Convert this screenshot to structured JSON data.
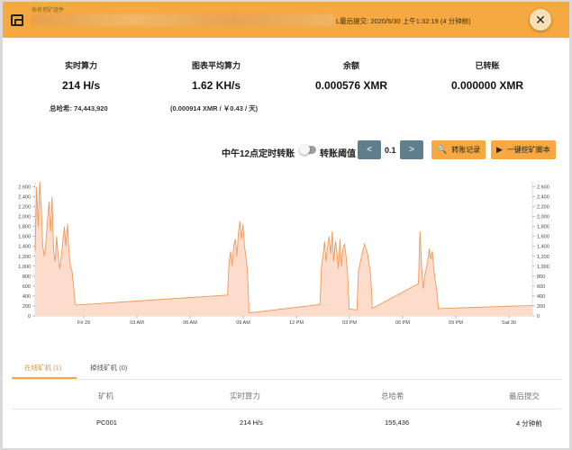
{
  "header": {
    "small_label": "命名挖矿组件",
    "last_submit": "L最后提交: 2020/5/30 上午1:32:19 (4 分钟前)",
    "close_icon": "close-icon"
  },
  "stats": {
    "realtime_label": "实时算力",
    "realtime_value": "214 H/s",
    "total_hashes": "总哈希: 74,443,920",
    "avg_label": "图表平均算力",
    "avg_value": "1.62 KH/s",
    "avg_sub": "(0.000914 XMR / ￥0.43 / 天)",
    "balance_label": "余额",
    "balance_value": "0.000576 XMR",
    "paid_label": "已转账",
    "paid_value": "0.000000 XMR"
  },
  "controls": {
    "noon_transfer_label": "中午12点定时转账",
    "threshold_label": "转账阈值",
    "threshold_value": "0.1",
    "decrease_symbol": "<",
    "increase_symbol": ">",
    "transfer_log": "转账记录",
    "one_click_script": "一键挖矿脚本"
  },
  "chart_data": {
    "type": "area",
    "color": "#f0995a",
    "fill": "#fddccb",
    "ylim": [
      0,
      2700
    ],
    "yticks": [
      0,
      200,
      400,
      600,
      800,
      1000,
      1200,
      1400,
      1600,
      1800,
      2000,
      2200,
      2400,
      2600
    ],
    "ytick_labels": [
      "0",
      "200",
      "400",
      "600",
      "800",
      "1,000",
      "1,200",
      "1,400",
      "1,600",
      "1,800",
      "2,000",
      "2,200",
      "2,400",
      "2,600"
    ],
    "xlim": [
      0,
      32.3
    ],
    "xticks": [
      3,
      9,
      15,
      21,
      27,
      33,
      39,
      45,
      51,
      57
    ],
    "xtick_labels": [
      "Fri 29",
      "03 AM",
      "06 AM",
      "09 AM",
      "12 PM",
      "03 PM",
      "06 PM",
      "09 PM",
      "Sat 30"
    ],
    "x_unit": "hours",
    "points": [
      [
        0.0,
        1300
      ],
      [
        0.1,
        2600
      ],
      [
        0.2,
        1800
      ],
      [
        0.3,
        2700
      ],
      [
        0.4,
        2200
      ],
      [
        0.5,
        1400
      ],
      [
        0.6,
        1200
      ],
      [
        0.7,
        1500
      ],
      [
        0.8,
        1900
      ],
      [
        0.9,
        2300
      ],
      [
        1.0,
        1700
      ],
      [
        1.1,
        2400
      ],
      [
        1.2,
        1300
      ],
      [
        1.3,
        1100
      ],
      [
        1.4,
        1600
      ],
      [
        1.5,
        1200
      ],
      [
        1.6,
        950
      ],
      [
        1.7,
        1200
      ],
      [
        1.8,
        1500
      ],
      [
        1.9,
        1800
      ],
      [
        2.0,
        1400
      ],
      [
        2.1,
        1850
      ],
      [
        2.2,
        1300
      ],
      [
        2.3,
        1000
      ],
      [
        2.4,
        900
      ],
      [
        2.5,
        600
      ],
      [
        2.6,
        250
      ],
      [
        2.7,
        220
      ],
      [
        12.5,
        420
      ],
      [
        12.6,
        1100
      ],
      [
        12.7,
        1300
      ],
      [
        12.8,
        1000
      ],
      [
        12.9,
        1400
      ],
      [
        13.0,
        1550
      ],
      [
        13.1,
        1200
      ],
      [
        13.2,
        1650
      ],
      [
        13.3,
        1900
      ],
      [
        13.4,
        1550
      ],
      [
        13.5,
        1850
      ],
      [
        13.6,
        1400
      ],
      [
        13.7,
        1200
      ],
      [
        13.8,
        900
      ],
      [
        13.9,
        60
      ],
      [
        18.5,
        230
      ],
      [
        18.6,
        1000
      ],
      [
        18.7,
        1200
      ],
      [
        18.8,
        1500
      ],
      [
        18.9,
        1100
      ],
      [
        19.0,
        1400
      ],
      [
        19.1,
        1600
      ],
      [
        19.2,
        1250
      ],
      [
        19.3,
        1700
      ],
      [
        19.4,
        1100
      ],
      [
        19.5,
        1500
      ],
      [
        19.6,
        1300
      ],
      [
        19.7,
        950
      ],
      [
        19.8,
        1550
      ],
      [
        19.9,
        1000
      ],
      [
        20.0,
        1350
      ],
      [
        20.1,
        1450
      ],
      [
        20.2,
        1200
      ],
      [
        20.3,
        850
      ],
      [
        20.4,
        140
      ],
      [
        20.9,
        120
      ],
      [
        21.0,
        900
      ],
      [
        21.2,
        1200
      ],
      [
        21.4,
        1450
      ],
      [
        21.6,
        1250
      ],
      [
        21.8,
        800
      ],
      [
        21.9,
        150
      ],
      [
        24.9,
        650
      ],
      [
        25.0,
        1700
      ],
      [
        25.1,
        1000
      ],
      [
        25.2,
        550
      ],
      [
        25.3,
        800
      ],
      [
        25.5,
        1100
      ],
      [
        25.6,
        1350
      ],
      [
        25.7,
        1150
      ],
      [
        25.8,
        1300
      ],
      [
        25.9,
        950
      ],
      [
        26.0,
        700
      ],
      [
        26.1,
        500
      ],
      [
        26.2,
        140
      ],
      [
        26.4,
        150
      ],
      [
        32.3,
        210
      ]
    ]
  },
  "tabs": {
    "online": "在线矿机 (1)",
    "offline": "掉线矿机 (0)"
  },
  "table": {
    "headers": [
      "矿机",
      "实时算力",
      "总哈希",
      "最后提交"
    ],
    "rows": [
      [
        "PC001",
        "214 H/s",
        "155,436",
        "4 分钟前"
      ]
    ]
  }
}
